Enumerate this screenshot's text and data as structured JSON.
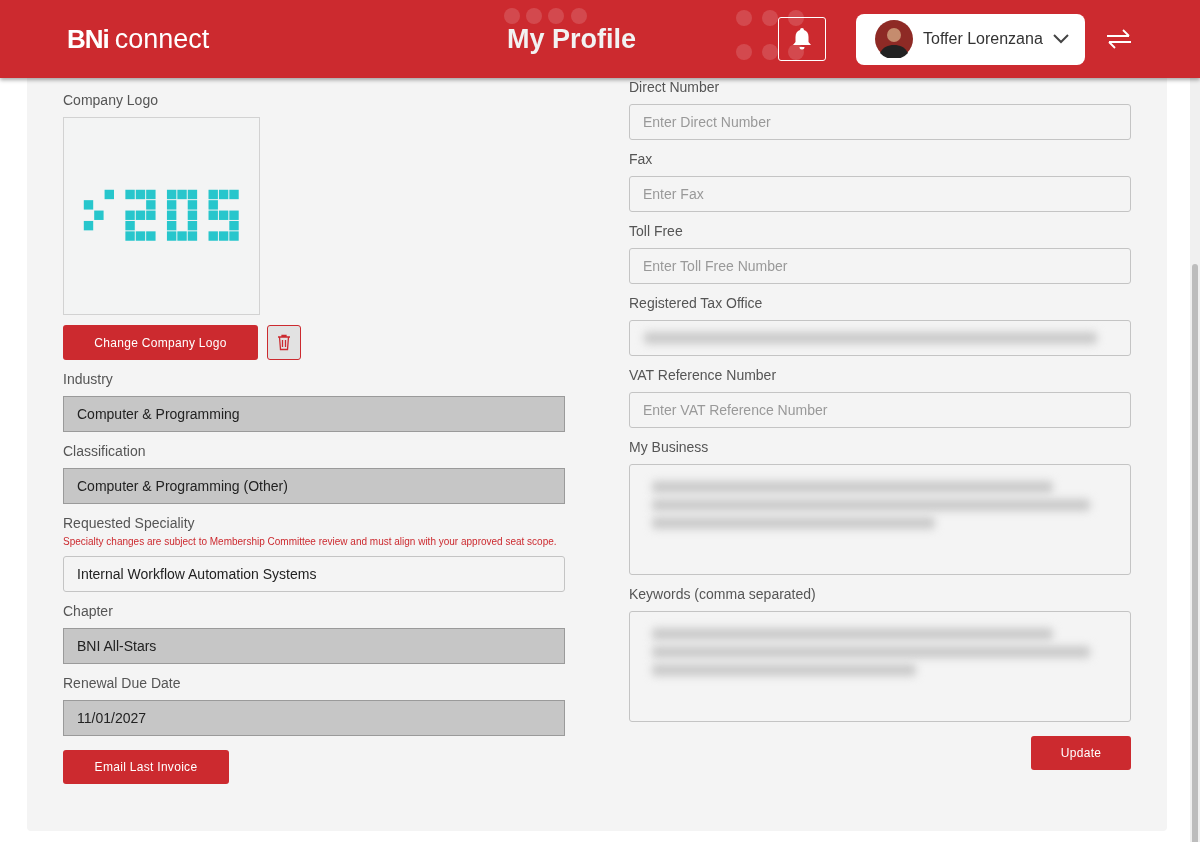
{
  "header": {
    "logo": {
      "brand": "BNi",
      "product": "connect"
    },
    "title": "My Profile",
    "user": {
      "name": "Toffer Lorenzana"
    }
  },
  "left": [
    {
      "kind": "logo",
      "label": "Company Logo",
      "action": "Change Company Logo"
    },
    {
      "kind": "locked",
      "label": "Industry",
      "value": "Computer & Programming"
    },
    {
      "kind": "locked",
      "label": "Classification",
      "value": "Computer & Programming (Other)"
    },
    {
      "kind": "text",
      "label": "Requested Speciality",
      "note": "Specialty changes are subject to Membership Committee review and must align with your approved seat scope.",
      "value": "Internal Workflow Automation Systems"
    },
    {
      "kind": "locked",
      "label": "Chapter",
      "value": "BNI All-Stars"
    },
    {
      "kind": "locked",
      "label": "Renewal Due Date",
      "value": "11/01/2027"
    },
    {
      "kind": "action",
      "label": "Email Last Invoice"
    }
  ],
  "right": [
    {
      "kind": "text",
      "label": "Direct Number",
      "placeholder": "Enter Direct Number"
    },
    {
      "kind": "text",
      "label": "Fax",
      "placeholder": "Enter Fax"
    },
    {
      "kind": "text",
      "label": "Toll Free",
      "placeholder": "Enter Toll Free Number"
    },
    {
      "kind": "blurred",
      "label": "Registered Tax Office"
    },
    {
      "kind": "text",
      "label": "VAT Reference Number",
      "placeholder": "Enter VAT Reference Number"
    },
    {
      "kind": "blurred-area",
      "label": "My Business"
    },
    {
      "kind": "blurred-area",
      "label": "Keywords (comma separated)"
    },
    {
      "kind": "submit",
      "label": "Update"
    }
  ]
}
